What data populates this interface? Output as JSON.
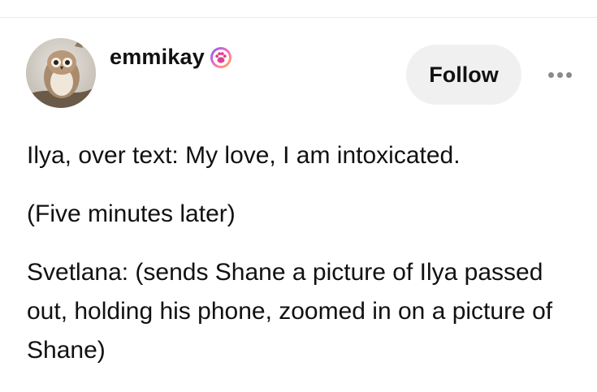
{
  "post": {
    "author": {
      "username": "emmikay",
      "avatar_icon": "owl-avatar",
      "badge_icon": "paw-badge-icon",
      "badge_colors": [
        "#7b5cff",
        "#ff6fb1",
        "#ffb347"
      ]
    },
    "follow_label": "Follow",
    "more_icon": "ellipsis-icon",
    "paragraphs": [
      "Ilya, over text: My love, I am intoxicated.",
      "(Five minutes later)",
      "Svetlana: (sends Shane a picture of Ilya passed out, holding his phone, zoomed in on a picture of Shane)"
    ]
  }
}
